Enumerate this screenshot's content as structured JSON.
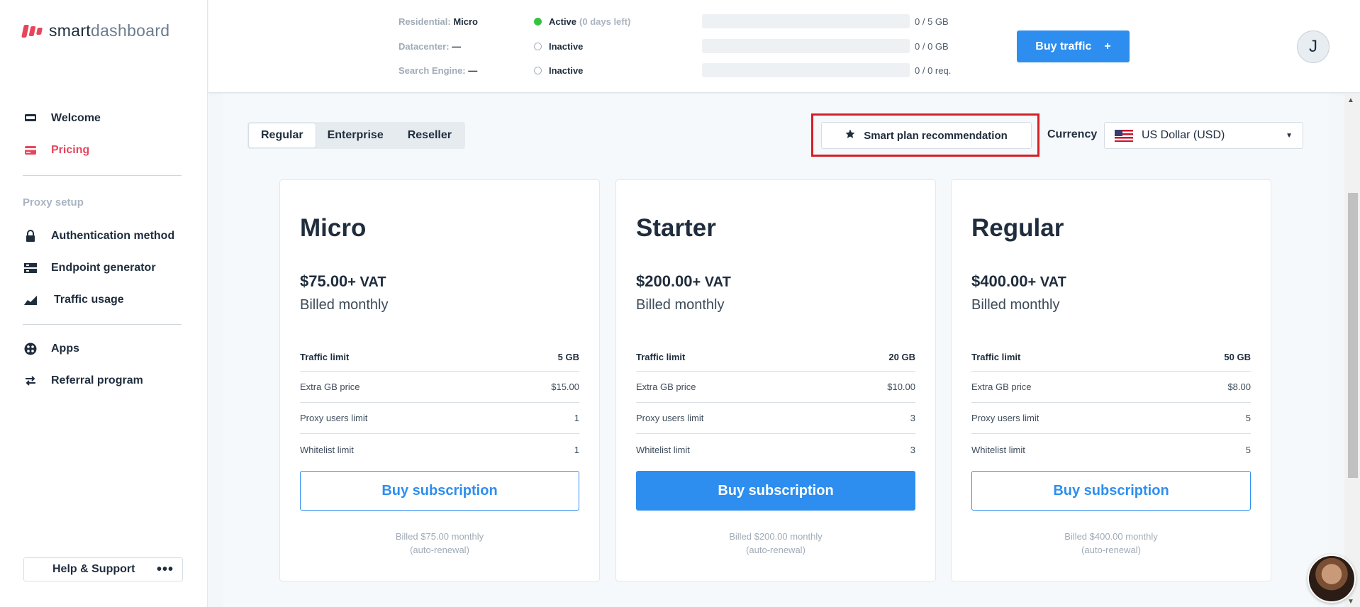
{
  "brand": {
    "part1": "smart",
    "part2": "dashboard"
  },
  "sidebar": {
    "items": [
      {
        "label": "Welcome"
      },
      {
        "label": "Pricing"
      }
    ],
    "section_label": "Proxy setup",
    "proxy_items": [
      {
        "label": "Authentication method"
      },
      {
        "label": "Endpoint generator"
      },
      {
        "label": "Traffic usage"
      }
    ],
    "other_items": [
      {
        "label": "Apps"
      },
      {
        "label": "Referral program"
      }
    ],
    "help_label": "Help & Support",
    "help_more": "•••"
  },
  "traffic": [
    {
      "label": "Residential:",
      "plan": "Micro",
      "status": "Active",
      "days": "(0 days left)",
      "amount": "0 / 5 GB",
      "active": true
    },
    {
      "label": "Datacenter:",
      "plan": "—",
      "status": "Inactive",
      "days": "",
      "amount": "0 / 0 GB",
      "active": false
    },
    {
      "label": "Search Engine:",
      "plan": "—",
      "status": "Inactive",
      "days": "",
      "amount": "0 / 0 req.",
      "active": false
    }
  ],
  "header": {
    "buy_traffic_label": "Buy traffic",
    "buy_traffic_icon": "+",
    "avatar_initial": "J"
  },
  "tabs": [
    {
      "label": "Regular",
      "active": true
    },
    {
      "label": "Enterprise",
      "active": false
    },
    {
      "label": "Reseller",
      "active": false
    }
  ],
  "smart_plan_label": "Smart plan recommendation",
  "currency": {
    "label": "Currency",
    "selected": "US Dollar (USD)"
  },
  "plans": [
    {
      "name": "Micro",
      "price": "$75.00",
      "vat": "+ VAT",
      "billing": "Billed monthly",
      "rows": [
        {
          "k": "Traffic limit",
          "v": "5 GB"
        },
        {
          "k": "Extra GB price",
          "v": "$15.00"
        },
        {
          "k": "Proxy users limit",
          "v": "1"
        },
        {
          "k": "Whitelist limit",
          "v": "1"
        }
      ],
      "button": "Buy subscription",
      "note1": "Billed $75.00 monthly",
      "note2": "(auto-renewal)"
    },
    {
      "name": "Starter",
      "price": "$200.00",
      "vat": "+ VAT",
      "billing": "Billed monthly",
      "rows": [
        {
          "k": "Traffic limit",
          "v": "20 GB"
        },
        {
          "k": "Extra GB price",
          "v": "$10.00"
        },
        {
          "k": "Proxy users limit",
          "v": "3"
        },
        {
          "k": "Whitelist limit",
          "v": "3"
        }
      ],
      "button": "Buy subscription",
      "note1": "Billed $200.00 monthly",
      "note2": "(auto-renewal)"
    },
    {
      "name": "Regular",
      "price": "$400.00",
      "vat": "+ VAT",
      "billing": "Billed monthly",
      "rows": [
        {
          "k": "Traffic limit",
          "v": "50 GB"
        },
        {
          "k": "Extra GB price",
          "v": "$8.00"
        },
        {
          "k": "Proxy users limit",
          "v": "5"
        },
        {
          "k": "Whitelist limit",
          "v": "5"
        }
      ],
      "button": "Buy subscription",
      "note1": "Billed $400.00 monthly",
      "note2": "(auto-renewal)"
    }
  ],
  "colors": {
    "brand_red": "#e6465c",
    "accent_blue": "#2d8ef0",
    "active_green": "#35c441",
    "highlight_red": "#d61f26"
  }
}
